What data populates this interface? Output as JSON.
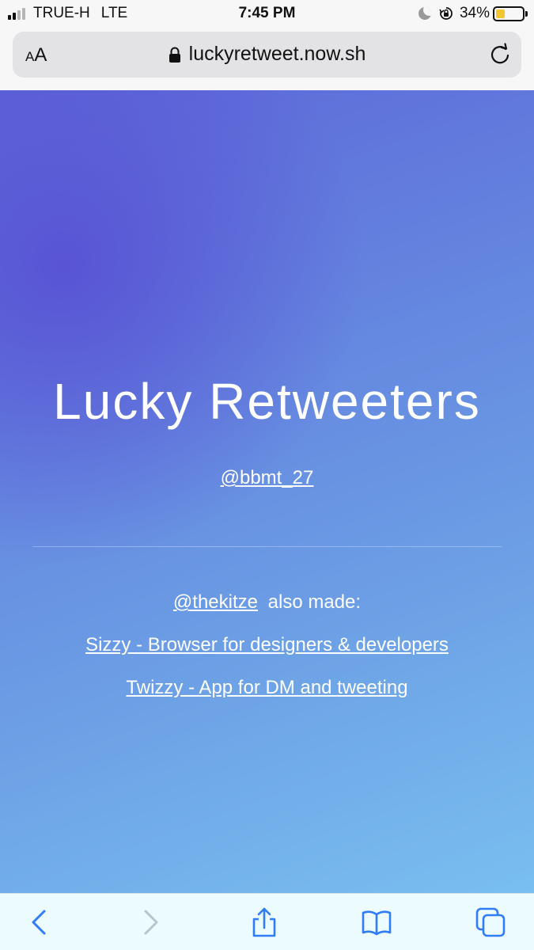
{
  "status_bar": {
    "carrier": "TRUE-H",
    "network": "LTE",
    "time": "7:45 PM",
    "battery": "34%",
    "battery_level": 0.34
  },
  "browser": {
    "text_size_label_small": "A",
    "text_size_label_large": "A",
    "url": "luckyretweet.now.sh"
  },
  "page": {
    "title": "Lucky Retweeters",
    "author_link": "@bbmt_27",
    "credits_link": "@thekitze",
    "credits_suffix": "also made:",
    "project_links": [
      "Sizzy - Browser for designers & developers",
      "Twizzy - App for DM and tweeting"
    ]
  },
  "toolbar": {
    "icons": [
      "back-icon",
      "forward-icon",
      "share-icon",
      "bookmarks-icon",
      "tabs-icon"
    ]
  },
  "colors": {
    "gradient_start": "#5852d4",
    "gradient_end": "#79bff0",
    "battery_fill": "#f2c531",
    "toolbar_icon": "#2f7cf6"
  }
}
